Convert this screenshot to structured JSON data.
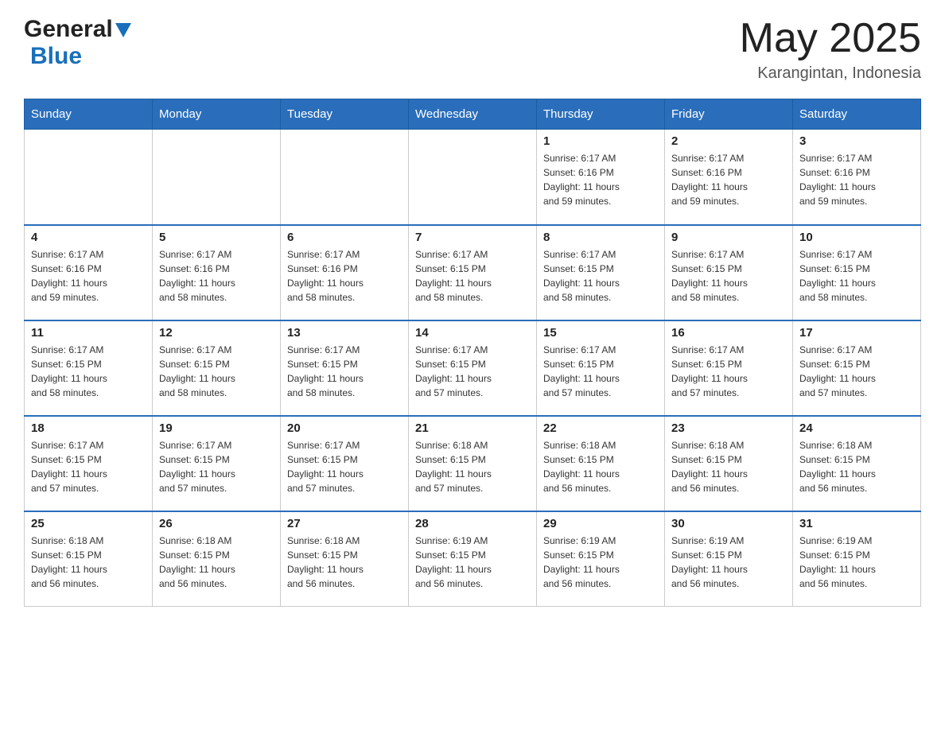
{
  "header": {
    "logo_text_general": "General",
    "logo_text_blue": "Blue",
    "month_year": "May 2025",
    "location": "Karangintan, Indonesia"
  },
  "weekdays": [
    "Sunday",
    "Monday",
    "Tuesday",
    "Wednesday",
    "Thursday",
    "Friday",
    "Saturday"
  ],
  "weeks": [
    [
      {
        "day": "",
        "info": ""
      },
      {
        "day": "",
        "info": ""
      },
      {
        "day": "",
        "info": ""
      },
      {
        "day": "",
        "info": ""
      },
      {
        "day": "1",
        "info": "Sunrise: 6:17 AM\nSunset: 6:16 PM\nDaylight: 11 hours\nand 59 minutes."
      },
      {
        "day": "2",
        "info": "Sunrise: 6:17 AM\nSunset: 6:16 PM\nDaylight: 11 hours\nand 59 minutes."
      },
      {
        "day": "3",
        "info": "Sunrise: 6:17 AM\nSunset: 6:16 PM\nDaylight: 11 hours\nand 59 minutes."
      }
    ],
    [
      {
        "day": "4",
        "info": "Sunrise: 6:17 AM\nSunset: 6:16 PM\nDaylight: 11 hours\nand 59 minutes."
      },
      {
        "day": "5",
        "info": "Sunrise: 6:17 AM\nSunset: 6:16 PM\nDaylight: 11 hours\nand 58 minutes."
      },
      {
        "day": "6",
        "info": "Sunrise: 6:17 AM\nSunset: 6:16 PM\nDaylight: 11 hours\nand 58 minutes."
      },
      {
        "day": "7",
        "info": "Sunrise: 6:17 AM\nSunset: 6:15 PM\nDaylight: 11 hours\nand 58 minutes."
      },
      {
        "day": "8",
        "info": "Sunrise: 6:17 AM\nSunset: 6:15 PM\nDaylight: 11 hours\nand 58 minutes."
      },
      {
        "day": "9",
        "info": "Sunrise: 6:17 AM\nSunset: 6:15 PM\nDaylight: 11 hours\nand 58 minutes."
      },
      {
        "day": "10",
        "info": "Sunrise: 6:17 AM\nSunset: 6:15 PM\nDaylight: 11 hours\nand 58 minutes."
      }
    ],
    [
      {
        "day": "11",
        "info": "Sunrise: 6:17 AM\nSunset: 6:15 PM\nDaylight: 11 hours\nand 58 minutes."
      },
      {
        "day": "12",
        "info": "Sunrise: 6:17 AM\nSunset: 6:15 PM\nDaylight: 11 hours\nand 58 minutes."
      },
      {
        "day": "13",
        "info": "Sunrise: 6:17 AM\nSunset: 6:15 PM\nDaylight: 11 hours\nand 58 minutes."
      },
      {
        "day": "14",
        "info": "Sunrise: 6:17 AM\nSunset: 6:15 PM\nDaylight: 11 hours\nand 57 minutes."
      },
      {
        "day": "15",
        "info": "Sunrise: 6:17 AM\nSunset: 6:15 PM\nDaylight: 11 hours\nand 57 minutes."
      },
      {
        "day": "16",
        "info": "Sunrise: 6:17 AM\nSunset: 6:15 PM\nDaylight: 11 hours\nand 57 minutes."
      },
      {
        "day": "17",
        "info": "Sunrise: 6:17 AM\nSunset: 6:15 PM\nDaylight: 11 hours\nand 57 minutes."
      }
    ],
    [
      {
        "day": "18",
        "info": "Sunrise: 6:17 AM\nSunset: 6:15 PM\nDaylight: 11 hours\nand 57 minutes."
      },
      {
        "day": "19",
        "info": "Sunrise: 6:17 AM\nSunset: 6:15 PM\nDaylight: 11 hours\nand 57 minutes."
      },
      {
        "day": "20",
        "info": "Sunrise: 6:17 AM\nSunset: 6:15 PM\nDaylight: 11 hours\nand 57 minutes."
      },
      {
        "day": "21",
        "info": "Sunrise: 6:18 AM\nSunset: 6:15 PM\nDaylight: 11 hours\nand 57 minutes."
      },
      {
        "day": "22",
        "info": "Sunrise: 6:18 AM\nSunset: 6:15 PM\nDaylight: 11 hours\nand 56 minutes."
      },
      {
        "day": "23",
        "info": "Sunrise: 6:18 AM\nSunset: 6:15 PM\nDaylight: 11 hours\nand 56 minutes."
      },
      {
        "day": "24",
        "info": "Sunrise: 6:18 AM\nSunset: 6:15 PM\nDaylight: 11 hours\nand 56 minutes."
      }
    ],
    [
      {
        "day": "25",
        "info": "Sunrise: 6:18 AM\nSunset: 6:15 PM\nDaylight: 11 hours\nand 56 minutes."
      },
      {
        "day": "26",
        "info": "Sunrise: 6:18 AM\nSunset: 6:15 PM\nDaylight: 11 hours\nand 56 minutes."
      },
      {
        "day": "27",
        "info": "Sunrise: 6:18 AM\nSunset: 6:15 PM\nDaylight: 11 hours\nand 56 minutes."
      },
      {
        "day": "28",
        "info": "Sunrise: 6:19 AM\nSunset: 6:15 PM\nDaylight: 11 hours\nand 56 minutes."
      },
      {
        "day": "29",
        "info": "Sunrise: 6:19 AM\nSunset: 6:15 PM\nDaylight: 11 hours\nand 56 minutes."
      },
      {
        "day": "30",
        "info": "Sunrise: 6:19 AM\nSunset: 6:15 PM\nDaylight: 11 hours\nand 56 minutes."
      },
      {
        "day": "31",
        "info": "Sunrise: 6:19 AM\nSunset: 6:15 PM\nDaylight: 11 hours\nand 56 minutes."
      }
    ]
  ]
}
